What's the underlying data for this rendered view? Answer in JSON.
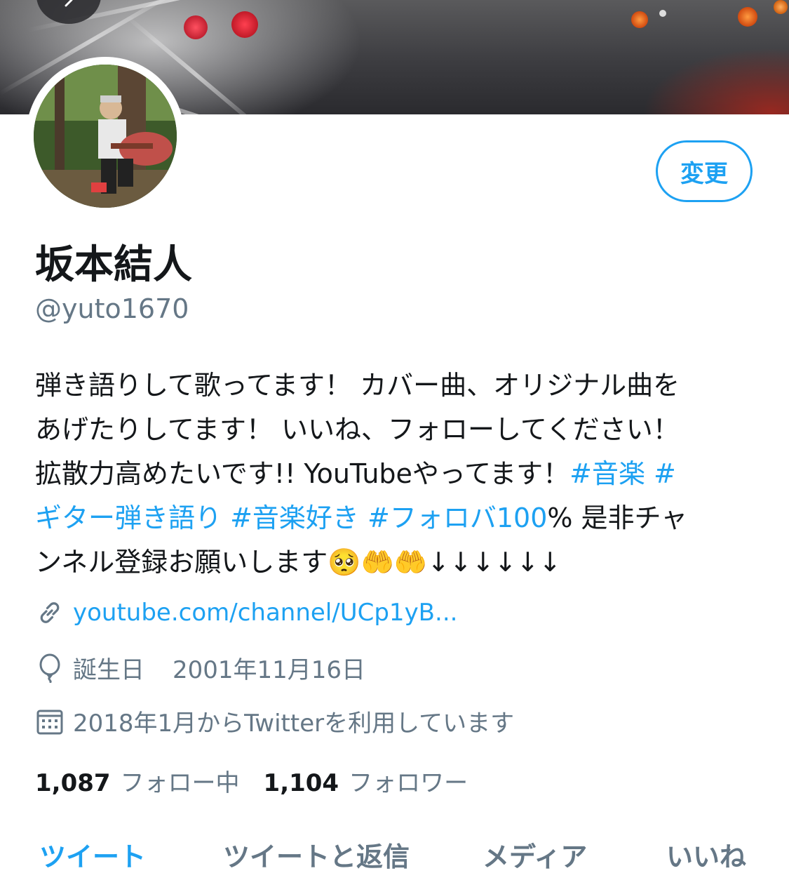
{
  "profile": {
    "edit_button": "変更",
    "name": "坂本結人",
    "handle": "@yuto1670",
    "bio_lines": [
      [
        "弾き語りして歌ってます！ カバー曲、オリジナル曲を"
      ],
      [
        "あげたりしてます！ いいね、フォローしてください！"
      ],
      [
        "拡散力高めたいです!! YouTubeやってます！",
        "#音楽 #"
      ],
      [
        "ギター弾き語り #音楽好き #フォロバ100",
        "% 是非チャ"
      ],
      [
        "ンネル登録お願いします",
        "🥺🤲🤲↓↓↓↓↓↓"
      ]
    ],
    "bio": {
      "l1": "弾き語りして歌ってます！ カバー曲、オリジナル曲を",
      "l2": "あげたりしてます！ いいね、フォローしてください！",
      "l3a": "拡散力高めたいです!! YouTubeやってます！",
      "l3b": "#音楽 #",
      "l4a": "ギター弾き語り #音楽好き #フォロバ100",
      "l4b": "% 是非チャ",
      "l5a": "ンネル登録お願いします",
      "l5b": "🥺🤲🤲↓↓↓↓↓↓"
    },
    "link": "youtube.com/channel/UCp1yB...",
    "birthday_label": "誕生日",
    "birthday": "2001年11月16日",
    "joined": "2018年1月からTwitterを利用しています",
    "following_count": "1,087",
    "following_label": "フォロー中",
    "followers_count": "1,104",
    "followers_label": "フォロワー"
  },
  "tabs": [
    "ツイート",
    "ツイートと返信",
    "メディア",
    "いいね"
  ],
  "colors": {
    "accent": "#1da1f2",
    "secondary_text": "#657786",
    "primary_text": "#14171a"
  }
}
